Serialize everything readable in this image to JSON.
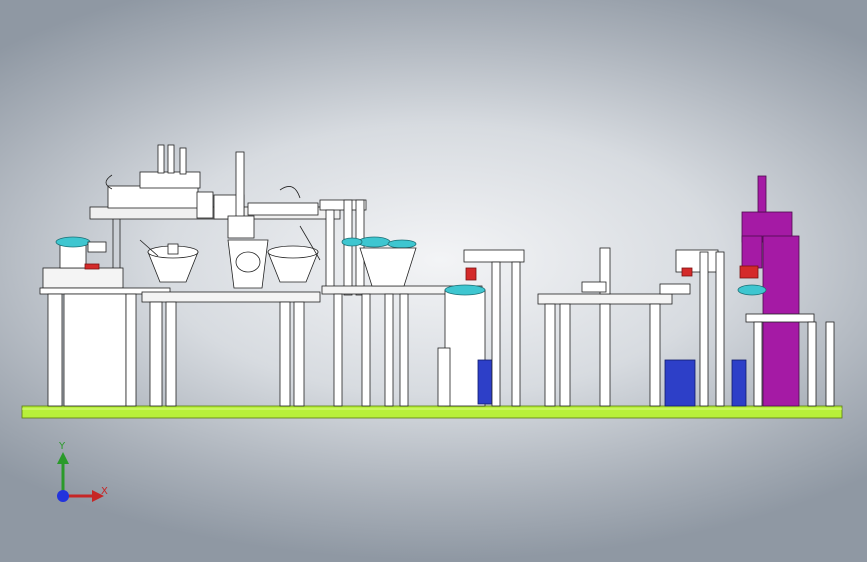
{
  "scene": {
    "colors": {
      "base_plate": "#b8f03a",
      "frame": "#ffffff",
      "frame_line": "#222222",
      "cyan_part": "#3ec6d0",
      "red_part": "#d42a2a",
      "blue_part": "#2d3fc8",
      "press_purple": "#a51aa5"
    },
    "components": [
      "base-plate",
      "left-cabinet",
      "gantry-robot",
      "vibratory-bowl-feeders",
      "assembly-table",
      "lift-modules",
      "rotary-table",
      "press-station"
    ]
  },
  "triad": {
    "y_label": "Y",
    "x_label": "X",
    "y_color": "#2a9a2a",
    "x_color": "#c62626",
    "z_color": "#2233dd"
  }
}
